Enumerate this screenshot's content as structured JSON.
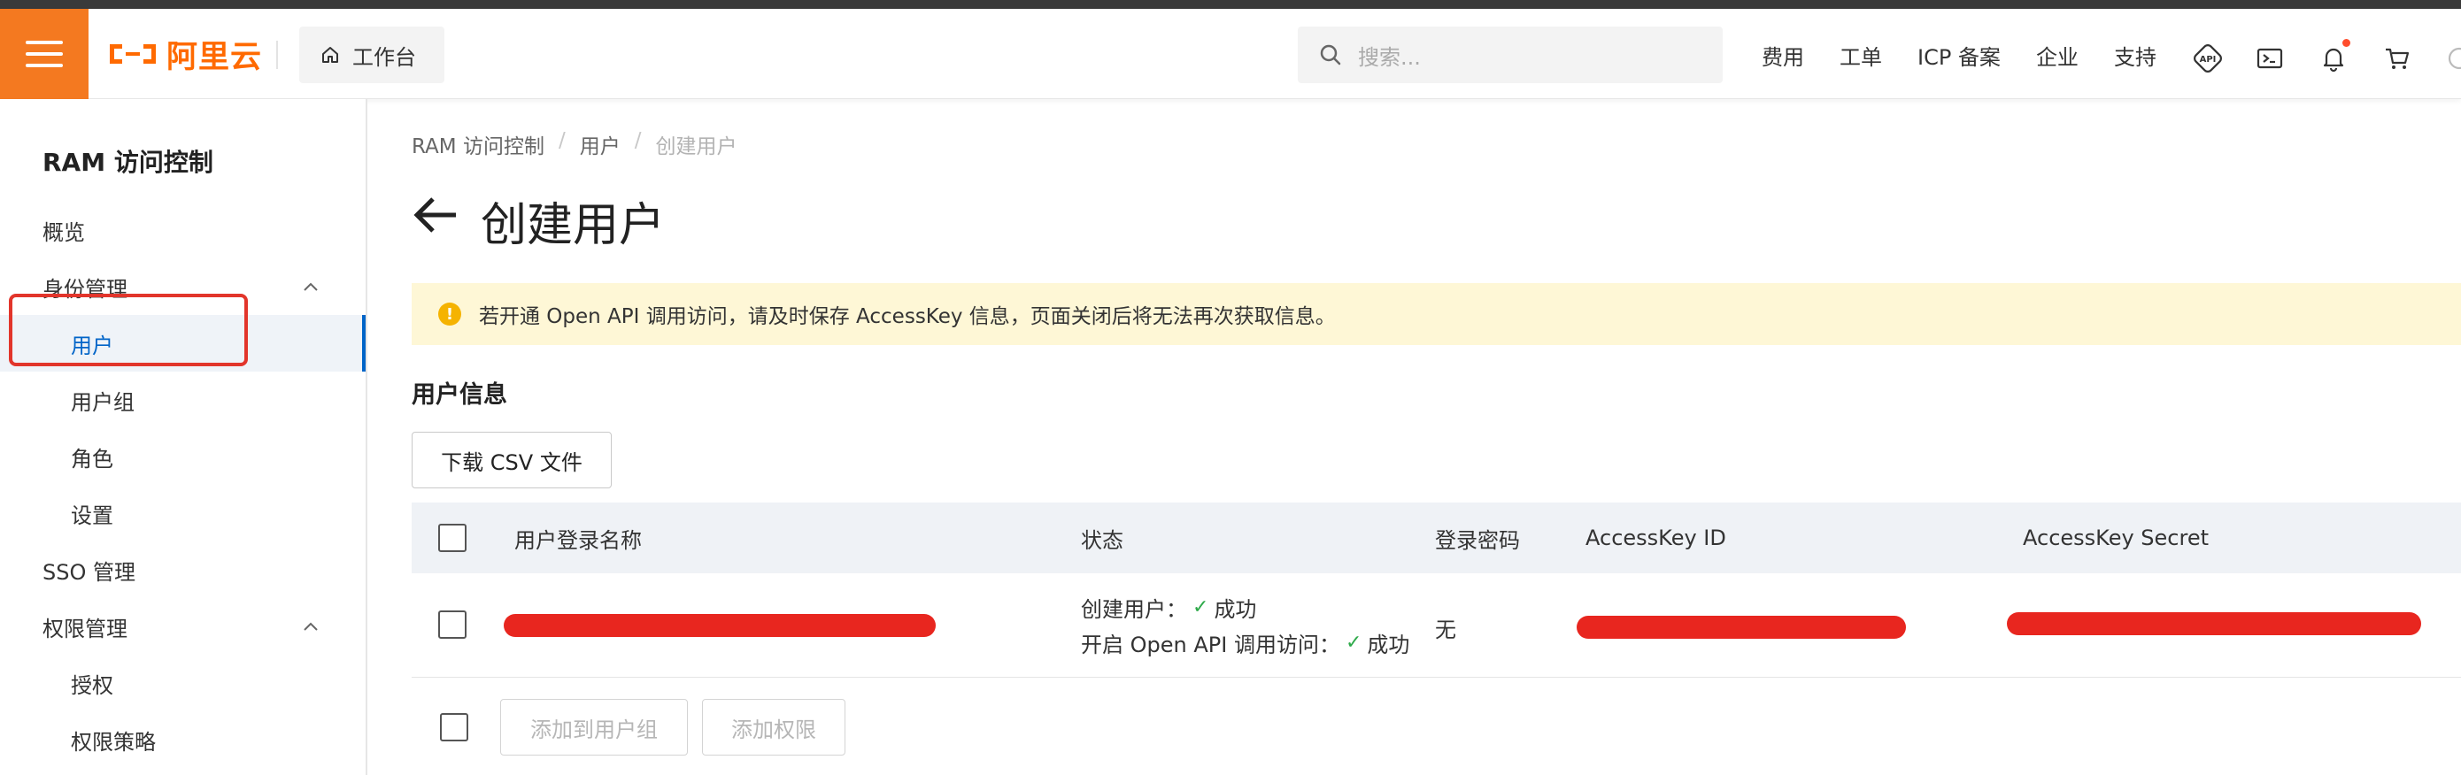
{
  "header": {
    "logo_text": "阿里云",
    "workbench_label": "工作台",
    "search_placeholder": "搜索...",
    "nav_links": [
      "费用",
      "工单",
      "ICP 备案",
      "企业",
      "支持"
    ],
    "icons": [
      "api-icon",
      "terminal-icon",
      "bell-icon",
      "cart-icon"
    ],
    "brand_color": "#ff6a00",
    "menu_color": "#f47920"
  },
  "sidebar": {
    "title": "RAM 访问控制",
    "items": [
      {
        "label": "概览",
        "level": 1
      },
      {
        "label": "身份管理",
        "level": 1,
        "expanded": true
      },
      {
        "label": "用户",
        "level": 2,
        "active": true
      },
      {
        "label": "用户组",
        "level": 2
      },
      {
        "label": "角色",
        "level": 2
      },
      {
        "label": "设置",
        "level": 2
      },
      {
        "label": "SSO 管理",
        "level": 1
      },
      {
        "label": "权限管理",
        "level": 1,
        "expanded": true
      },
      {
        "label": "授权",
        "level": 2
      },
      {
        "label": "权限策略",
        "level": 2
      }
    ]
  },
  "breadcrumb": [
    "RAM 访问控制",
    "用户",
    "创建用户"
  ],
  "page": {
    "title": "创建用户",
    "notice": "若开通 Open API 调用访问，请及时保存 AccessKey 信息，页面关闭后将无法再次获取信息。",
    "section_title": "用户信息",
    "download_button": "下载 CSV 文件"
  },
  "table": {
    "columns": [
      "用户登录名称",
      "状态",
      "登录密码",
      "AccessKey ID",
      "AccessKey Secret"
    ],
    "rows": [
      {
        "login_name": "[redacted]",
        "status": [
          {
            "label": "创建用户：",
            "result": "成功"
          },
          {
            "label": "开启 Open API 调用访问：",
            "result": "成功"
          }
        ],
        "password": "无",
        "access_key_id": "[redacted]",
        "access_key_secret": "[redacted]"
      }
    ],
    "footer_buttons": [
      "添加到用户组",
      "添加权限"
    ]
  }
}
